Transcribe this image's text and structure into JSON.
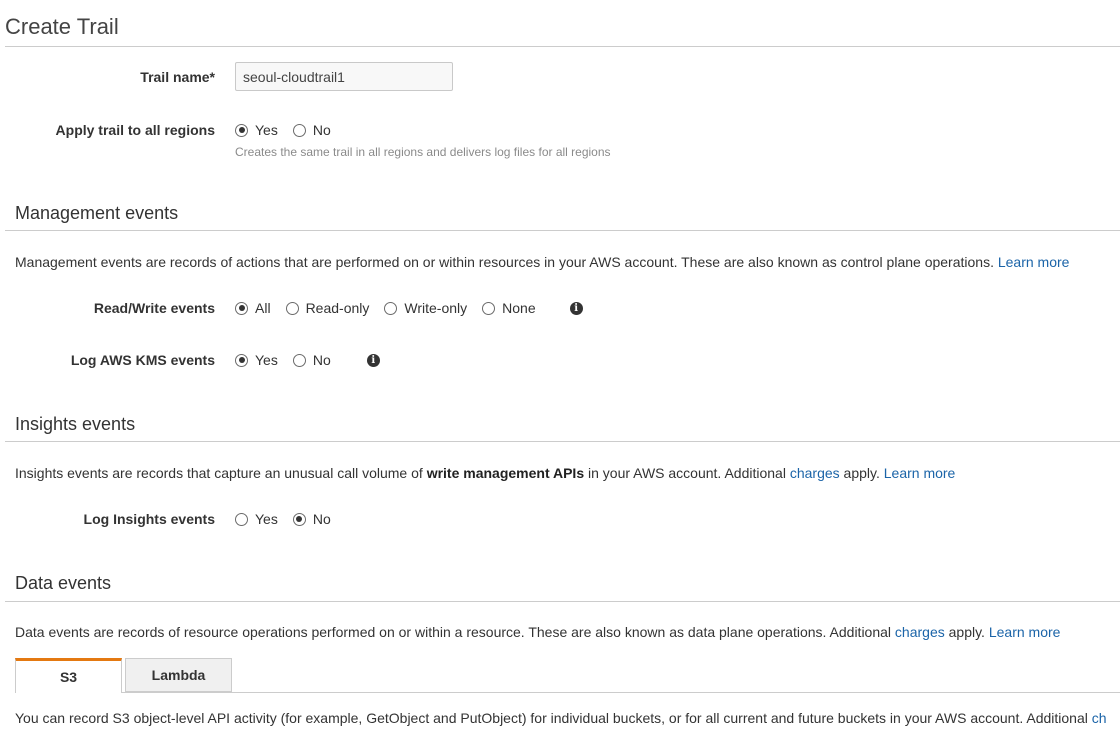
{
  "page": {
    "title": "Create Trail"
  },
  "trail_name": {
    "label": "Trail name*",
    "value": "seoul-cloudtrail1"
  },
  "apply_all_regions": {
    "label": "Apply trail to all regions",
    "options": [
      "Yes",
      "No"
    ],
    "selected": "Yes",
    "help": "Creates the same trail in all regions and delivers log files for all regions"
  },
  "management": {
    "title": "Management events",
    "description": "Management events are records of actions that are performed on or within resources in your AWS account. These are also known as control plane operations.",
    "learn_more": "Learn more",
    "read_write": {
      "label": "Read/Write events",
      "options": [
        "All",
        "Read-only",
        "Write-only",
        "None"
      ],
      "selected": "All",
      "info_icon": "info-icon"
    },
    "kms": {
      "label": "Log AWS KMS events",
      "options": [
        "Yes",
        "No"
      ],
      "selected": "Yes",
      "info_icon": "info-icon"
    }
  },
  "insights": {
    "title": "Insights events",
    "description_pre": "Insights events are records that capture an unusual call volume of",
    "description_bold": "write management APIs",
    "description_mid": "in your AWS account. Additional",
    "charges": "charges",
    "apply": "apply.",
    "learn_more": "Learn more",
    "log": {
      "label": "Log Insights events",
      "options": [
        "Yes",
        "No"
      ],
      "selected": "No"
    }
  },
  "data_events": {
    "title": "Data events",
    "description_pre": "Data events are records of resource operations performed on or within a resource. These are also known as data plane operations. Additional",
    "charges": "charges",
    "apply": "apply.",
    "learn_more": "Learn more",
    "tabs": [
      "S3",
      "Lambda"
    ],
    "active_tab": "S3",
    "s3_text": "You can record S3 object-level API activity (for example, GetObject and PutObject) for individual buckets, or for all current and future buckets in your AWS account. Additional",
    "s3_link_partial": "ch"
  },
  "colors": {
    "link": "#1b64a8",
    "tab_accent": "#e47911",
    "rule": "#cccccc"
  }
}
